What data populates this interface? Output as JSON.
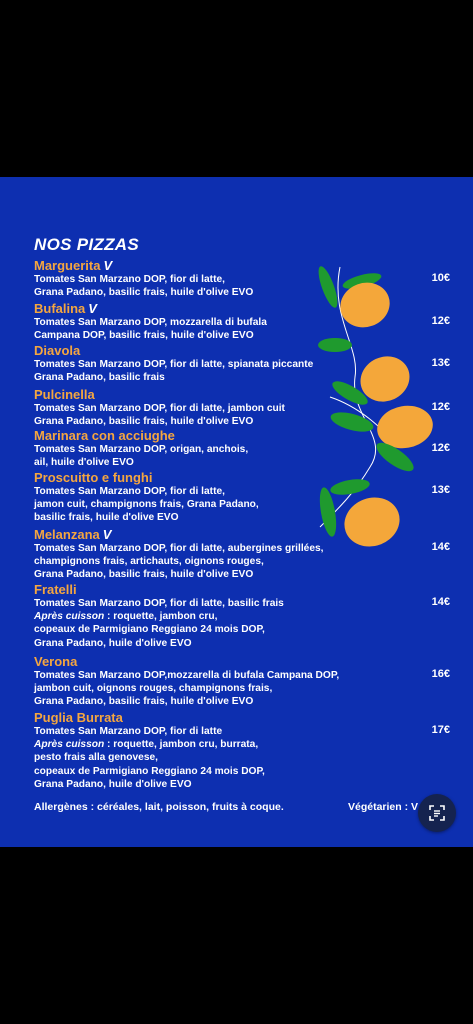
{
  "menu": {
    "title": "NOS PIZZAS",
    "veg_mark": "V",
    "items": [
      {
        "name": "Marguerita",
        "veg": true,
        "desc": [
          "Tomates San Marzano DOP, fior di latte,",
          "Grana Padano, basilic frais, huile d'olive EVO"
        ],
        "price": "10€"
      },
      {
        "name": "Bufalina",
        "veg": true,
        "desc": [
          "Tomates San Marzano DOP, mozzarella di bufala",
          "Campana DOP, basilic frais, huile d'olive EVO"
        ],
        "price": "12€"
      },
      {
        "name": "Diavola",
        "veg": false,
        "desc": [
          "Tomates San Marzano DOP, fior di latte, spianata piccante",
          "Grana Padano, basilic frais"
        ],
        "price": "13€"
      },
      {
        "name": "Pulcinella",
        "veg": false,
        "desc": [
          "Tomates San Marzano DOP, fior di latte, jambon cuit",
          "Grana Padano, basilic frais, huile d'olive EVO"
        ],
        "price": "12€"
      },
      {
        "name": "Marinara con acciughe",
        "veg": false,
        "desc": [
          "Tomates San Marzano DOP,  origan, anchois,",
          "ail, huile d'olive EVO"
        ],
        "price": "12€"
      },
      {
        "name": "Proscuitto e funghi",
        "veg": false,
        "desc": [
          "Tomates San Marzano DOP, fior di latte,",
          "jamon cuit, champignons frais, Grana Padano,",
          "basilic frais, huile d'olive EVO"
        ],
        "price": "13€"
      },
      {
        "name": "Melanzana",
        "veg": true,
        "desc": [
          "Tomates San Marzano DOP, fior di latte, aubergines grillées,",
          "champignons frais, artichauts, oignons rouges,",
          "Grana Padano, basilic frais, huile d'olive EVO"
        ],
        "price": "14€"
      },
      {
        "name": "Fratelli",
        "veg": false,
        "desc": [
          "Tomates San Marzano DOP, fior di latte, basilic frais",
          "Après cuisson : roquette, jambon cru,",
          "copeaux de Parmigiano Reggiano 24 mois DOP,",
          "Grana Padano, huile d'olive EVO"
        ],
        "price": "14€"
      },
      {
        "name": "Verona",
        "veg": false,
        "desc": [
          "Tomates San Marzano DOP,mozzarella di bufala Campana DOP,",
          "jambon cuit, oignons rouges, champignons frais,",
          "Grana Padano, basilic frais, huile d'olive EVO"
        ],
        "price": "16€"
      },
      {
        "name": "Puglia Burrata",
        "veg": false,
        "desc": [
          "Tomates San Marzano DOP, fior di latte",
          "Après cuisson : roquette, jambon cru, burrata,",
          "pesto frais alla genovese,",
          "copeaux de Parmigiano Reggiano 24 mois DOP,",
          "Grana Padano, huile d'olive EVO"
        ],
        "price": "17€"
      }
    ],
    "allergens": "Allergènes : céréales, lait, poisson, fruits à coque.",
    "vegetarian": "Végétarien : V"
  },
  "colors": {
    "background": "#0d2fb0",
    "accent": "#f4a640",
    "lemon": "#f4a73a",
    "leaf": "#1f9a2e"
  },
  "icons": {
    "lens": "google-lens-icon"
  }
}
